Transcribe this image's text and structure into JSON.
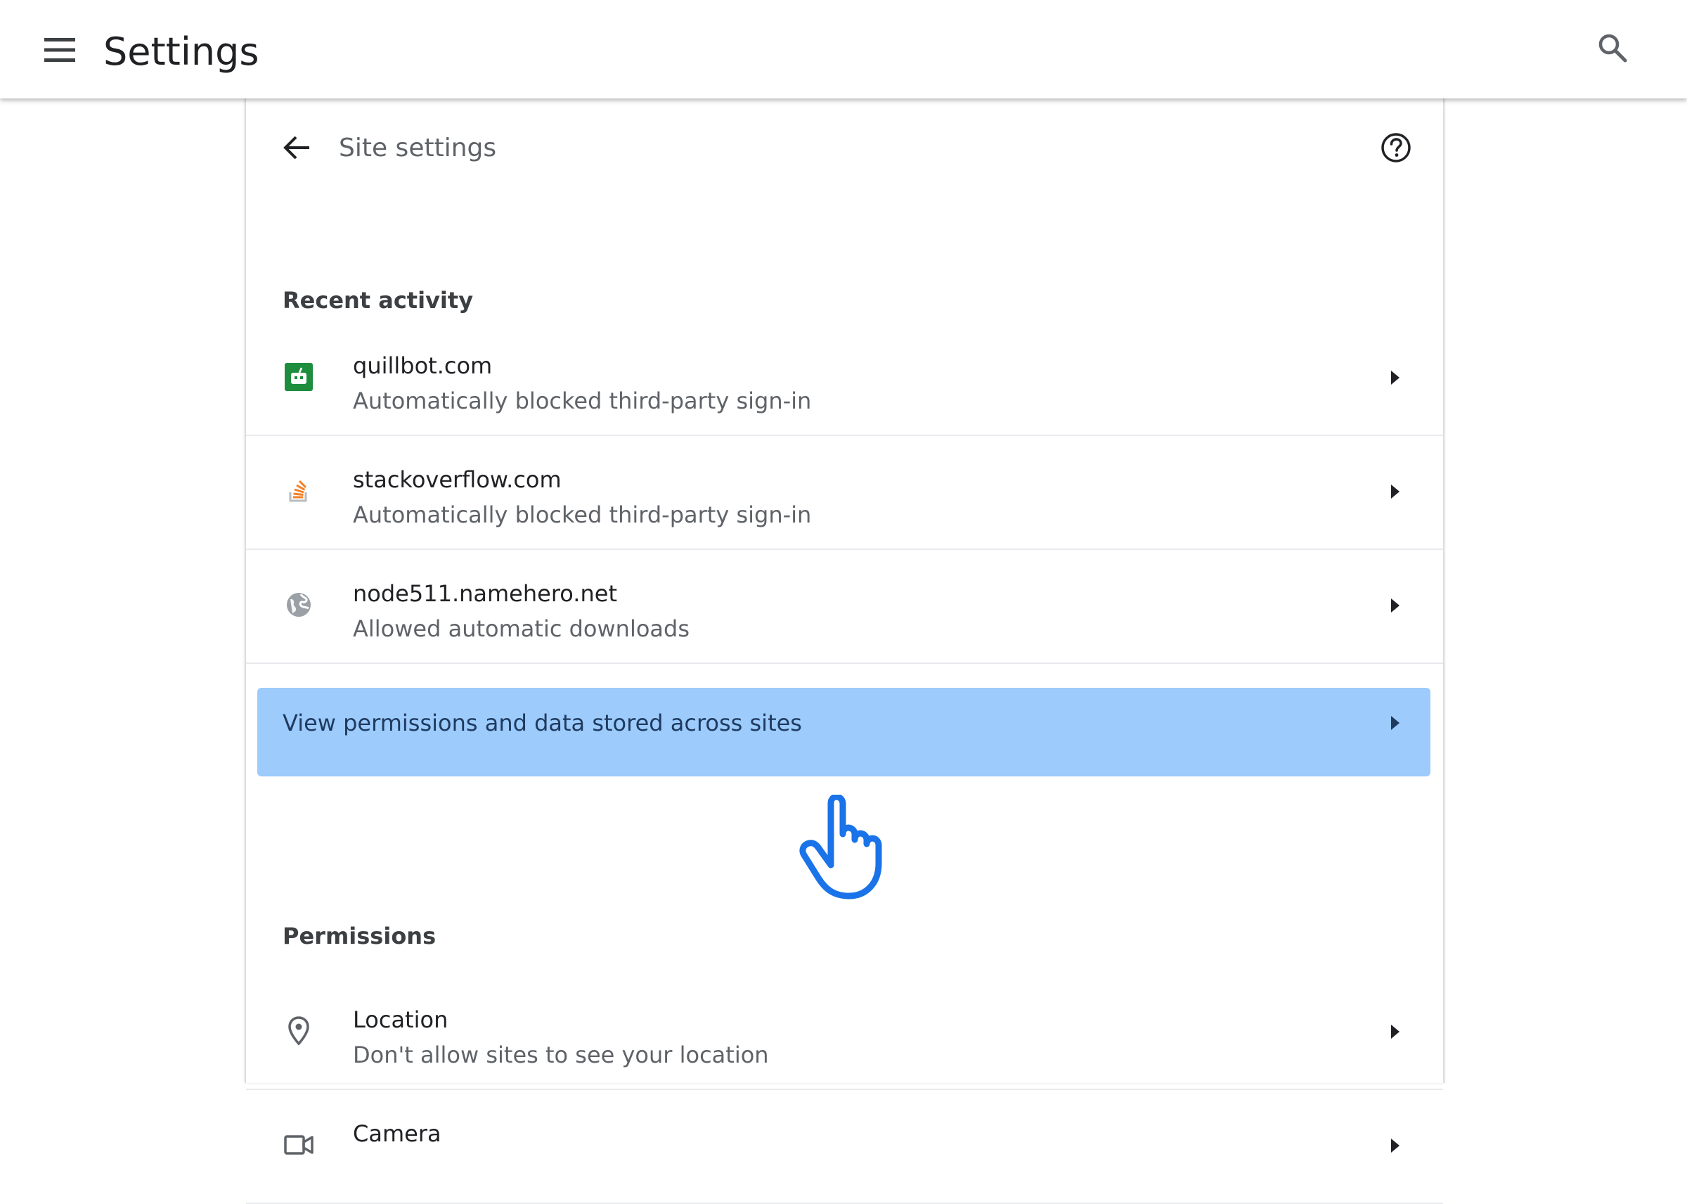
{
  "app": {
    "title": "Settings",
    "menu_icon": "hamburger-menu-icon",
    "search_icon": "search-icon"
  },
  "page": {
    "title": "Site settings",
    "back_icon": "back-arrow-icon",
    "help_icon": "help-circle-icon"
  },
  "recent_activity": {
    "heading": "Recent activity",
    "items": [
      {
        "site": "quillbot.com",
        "detail": "Automatically blocked third-party sign-in",
        "icon": "quillbot-favicon-icon",
        "icon_color": "#1e8e3e"
      },
      {
        "site": "stackoverflow.com",
        "detail": "Automatically blocked third-party sign-in",
        "icon": "stackoverflow-favicon-icon",
        "icon_color": "#f48024"
      },
      {
        "site": "node511.namehero.net",
        "detail": "Allowed automatic downloads",
        "icon": "globe-icon",
        "icon_color": "#9aa0a6"
      }
    ],
    "view_all_label": "View permissions and data stored across sites",
    "view_all_highlight_color": "#9ccbfc"
  },
  "permissions": {
    "heading": "Permissions",
    "items": [
      {
        "name": "Location",
        "detail": "Don't allow sites to see your location",
        "icon": "location-pin-icon"
      },
      {
        "name": "Camera",
        "detail": "",
        "icon": "camera-icon"
      }
    ]
  },
  "cursor": {
    "icon": "pointer-hand-icon",
    "color": "#1a73e8"
  }
}
